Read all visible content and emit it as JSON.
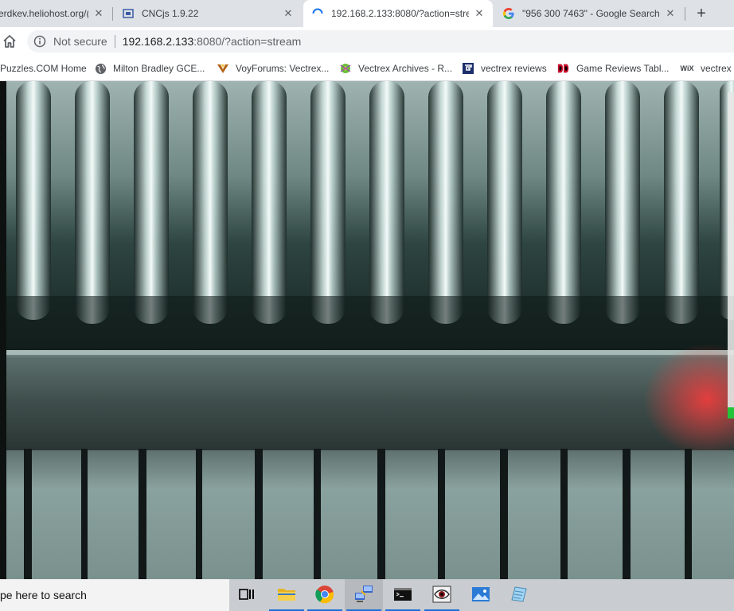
{
  "tabs": [
    {
      "title": "erdkev.heliohost.org/(",
      "close": "✕",
      "active": false
    },
    {
      "title": "CNCjs 1.9.22",
      "close": "✕",
      "active": false
    },
    {
      "title": "192.168.2.133:8080/?action=stre",
      "close": "✕",
      "active": true
    },
    {
      "title": "\"956 300 7463\" - Google Search",
      "close": "✕",
      "active": false
    }
  ],
  "new_tab": "+",
  "omnibox": {
    "security_label": "Not secure",
    "host": "192.168.2.133",
    "path": ":8080/?action=stream"
  },
  "bookmarks": [
    {
      "label": "Puzzles.COM Home",
      "icon": "none"
    },
    {
      "label": "Milton Bradley GCE...",
      "icon": "globe-icon"
    },
    {
      "label": "VoyForums: Vectrex...",
      "icon": "voyforums-icon"
    },
    {
      "label": "Vectrex Archives - R...",
      "icon": "archive-icon"
    },
    {
      "label": "vectrex reviews",
      "icon": "reviews-icon"
    },
    {
      "label": "Game Reviews Tabl...",
      "icon": "dd-icon"
    },
    {
      "label": "vectrex r",
      "icon": "wix-icon",
      "icon_text": "WiX"
    }
  ],
  "taskbar": {
    "search_placeholder": "pe here to search",
    "apps": [
      "task-view",
      "file-explorer",
      "chrome",
      "network-app",
      "command-prompt",
      "eye-app",
      "photos",
      "notes-app"
    ]
  },
  "colors": {
    "tabstrip": "#dee1e6",
    "accent": "#1a73e8",
    "taskbar": "#c9ccd0"
  }
}
